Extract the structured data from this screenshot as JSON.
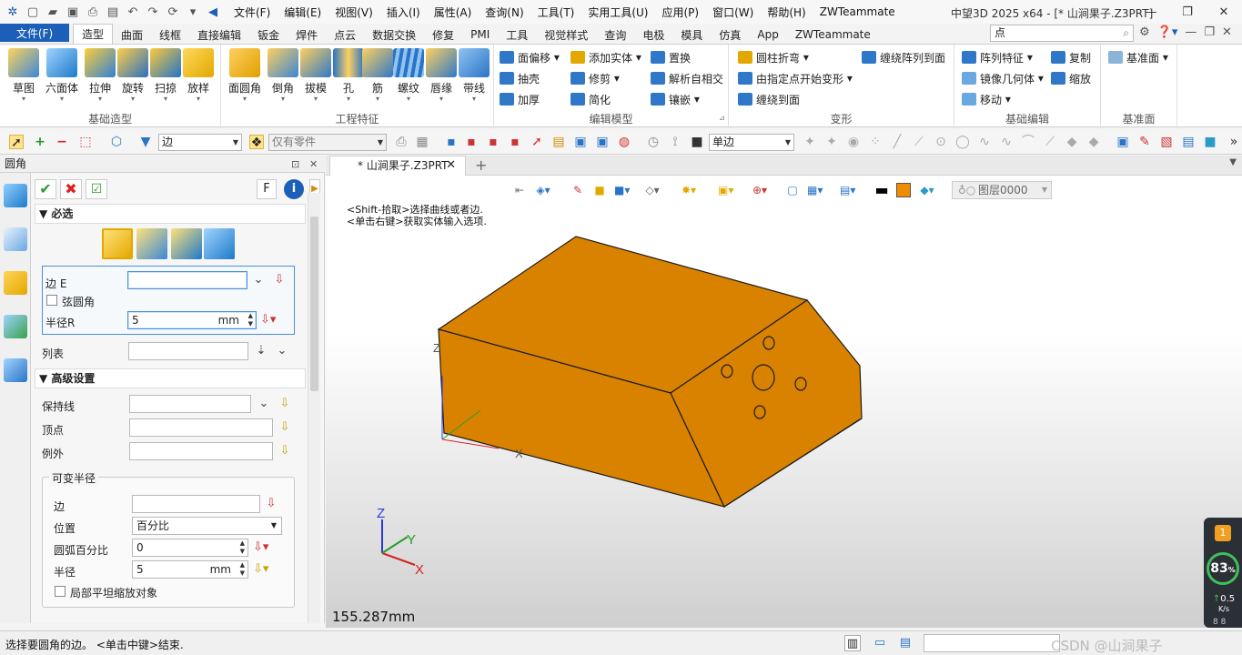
{
  "window": {
    "title": "中望3D 2025 x64 - [* 山涧果子.Z3PRT]",
    "menu": [
      "文件(F)",
      "编辑(E)",
      "视图(V)",
      "插入(I)",
      "属性(A)",
      "查询(N)",
      "工具(T)",
      "实用工具(U)",
      "应用(P)",
      "窗口(W)",
      "帮助(H)",
      "ZWTeammate"
    ],
    "controls": {
      "minimize": "—",
      "restore": "❐",
      "close": "✕"
    }
  },
  "ribbon": {
    "file_tab": "文件(F)",
    "tabs": [
      "造型",
      "曲面",
      "线框",
      "直接编辑",
      "钣金",
      "焊件",
      "点云",
      "数据交换",
      "修复",
      "PMI",
      "工具",
      "视觉样式",
      "查询",
      "电极",
      "模具",
      "仿真",
      "App",
      "ZWTeammate"
    ],
    "active_tab": "造型",
    "search_value": "点",
    "groups": {
      "basic": {
        "label": "基础造型",
        "buttons": [
          "草图",
          "六面体",
          "拉伸",
          "旋转",
          "扫掠",
          "放样"
        ]
      },
      "engineering": {
        "label": "工程特征",
        "buttons": [
          "面圆角",
          "倒角",
          "拔模",
          "孔",
          "筋",
          "螺纹",
          "唇缘",
          "带线"
        ]
      },
      "edit_model": {
        "label": "编辑模型",
        "items": [
          "面偏移",
          "抽壳",
          "加厚",
          "添加实体",
          "修剪",
          "简化",
          "置换",
          "解析自相交",
          "镶嵌"
        ]
      },
      "deform": {
        "label": "变形",
        "items": [
          "圆柱折弯",
          "由指定点开始变形",
          "缠绕到面",
          "缠绕阵列到面"
        ]
      },
      "basic_edit": {
        "label": "基础编辑",
        "items": [
          "阵列特征",
          "镜像几何体",
          "移动",
          "复制",
          "缩放"
        ]
      },
      "datum": {
        "label": "基准面",
        "items": [
          "基准面"
        ]
      }
    }
  },
  "toolbar": {
    "filter_value": "边",
    "scope_value": "仅有零件",
    "edge_mode_value": "单边"
  },
  "panel": {
    "title": "圆角",
    "head_controls": {
      "pin": "⊡",
      "close": "✕"
    },
    "f_button": "F",
    "info_button": "i",
    "required": {
      "header": "必选",
      "edge_label": "边 E",
      "edge_value": "",
      "chord_label": "弦圆角",
      "radius_label": "半径R",
      "radius_value": "5",
      "radius_unit": "mm",
      "list_label": "列表",
      "list_value": ""
    },
    "advanced": {
      "header": "高级设置",
      "keep_line_label": "保持线",
      "vertex_label": "顶点",
      "exception_label": "例外",
      "variable_radius": {
        "title": "可变半径",
        "edge_label": "边",
        "position_label": "位置",
        "position_value": "百分比",
        "arc_percent_label": "圆弧百分比",
        "arc_percent_value": "0",
        "radius_label": "半径",
        "radius_value": "5",
        "radius_unit": "mm",
        "local_flat_label": "局部平坦缩放对象"
      }
    }
  },
  "document": {
    "tab_label": "* 山涧果子.Z3PRT",
    "tab_close": "✕",
    "new_tab": "+"
  },
  "viewport": {
    "hints": [
      "<Shift-拾取>选择曲线或者边.",
      "<单击右键>获取实体输入选项."
    ],
    "layer_value": "图层0000",
    "scale_readout": "155.287mm",
    "triad": {
      "x": "X",
      "y": "Y",
      "z": "Z"
    },
    "model_color": "#d98200",
    "swatch_color": "#f08c00"
  },
  "net_widget": {
    "cpu_percent": "83",
    "cpu_unit": "%",
    "speed_value": "0.5",
    "speed_unit": "K/s",
    "bottom_value": "8 8"
  },
  "status": {
    "text": "选择要圆角的边。 <单击中键>结束.",
    "watermark": "CSDN @山涧果子"
  }
}
